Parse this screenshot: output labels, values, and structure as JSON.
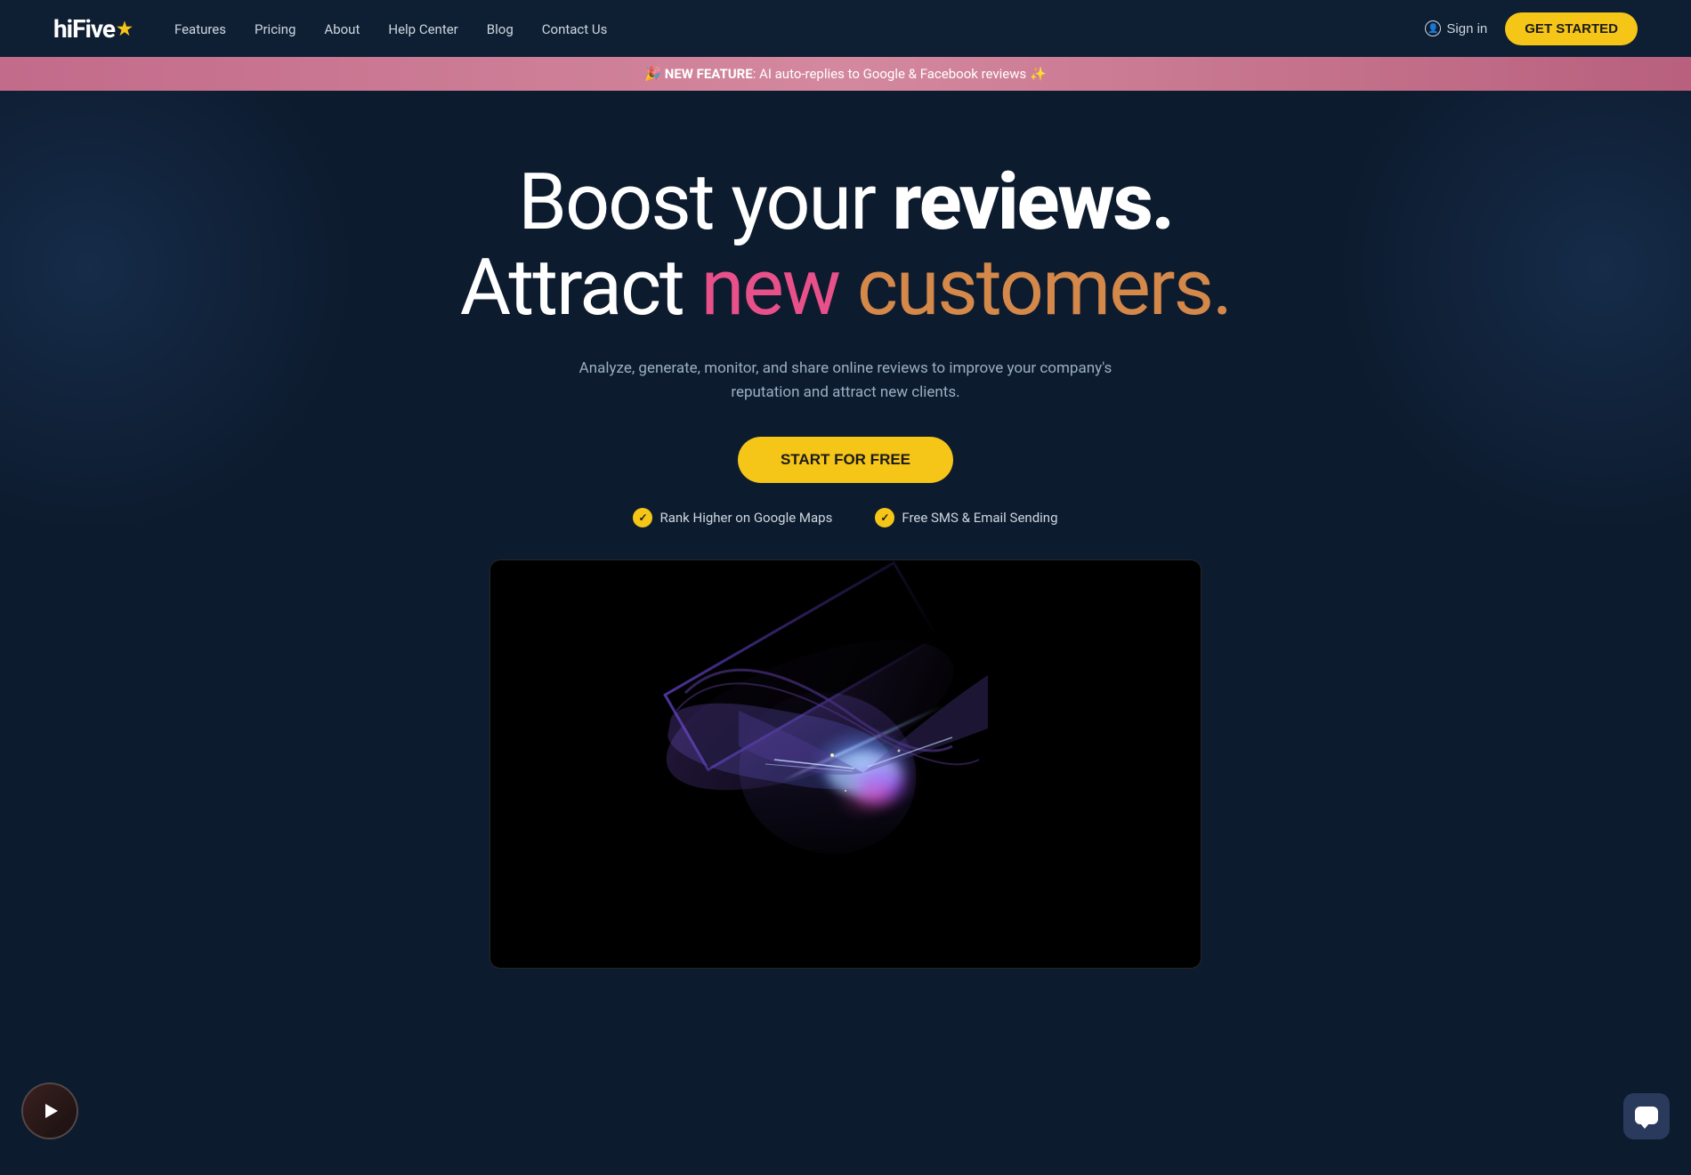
{
  "navbar": {
    "logo": {
      "text": "hiFive",
      "star": "★"
    },
    "links": [
      {
        "label": "Features",
        "href": "#"
      },
      {
        "label": "Pricing",
        "href": "#"
      },
      {
        "label": "About",
        "href": "#"
      },
      {
        "label": "Help Center",
        "href": "#"
      },
      {
        "label": "Blog",
        "href": "#"
      },
      {
        "label": "Contact Us",
        "href": "#"
      }
    ],
    "signin_label": "Sign in",
    "get_started_label": "GET STARTED"
  },
  "announcement": {
    "emoji": "🎉",
    "prefix": "NEW FEATURE",
    "text": ": AI auto-replies to Google & Facebook reviews ✨"
  },
  "hero": {
    "title_line1_regular": "Boost your ",
    "title_line1_bold": "reviews.",
    "title_line2_regular": "Attract ",
    "title_line2_pink": "new",
    "title_line2_space": " ",
    "title_line2_orange": "customers.",
    "subtitle": "Analyze, generate, monitor, and share online reviews to improve  your company's reputation and attract new clients.",
    "cta_label": "START FOR FREE",
    "badges": [
      {
        "icon": "✓",
        "text": "Rank Higher on Google Maps"
      },
      {
        "icon": "✓",
        "text": "Free SMS & Email Sending"
      }
    ]
  },
  "floating_video": {
    "aria_label": "Watch video"
  },
  "chat_button": {
    "aria_label": "Open chat"
  }
}
